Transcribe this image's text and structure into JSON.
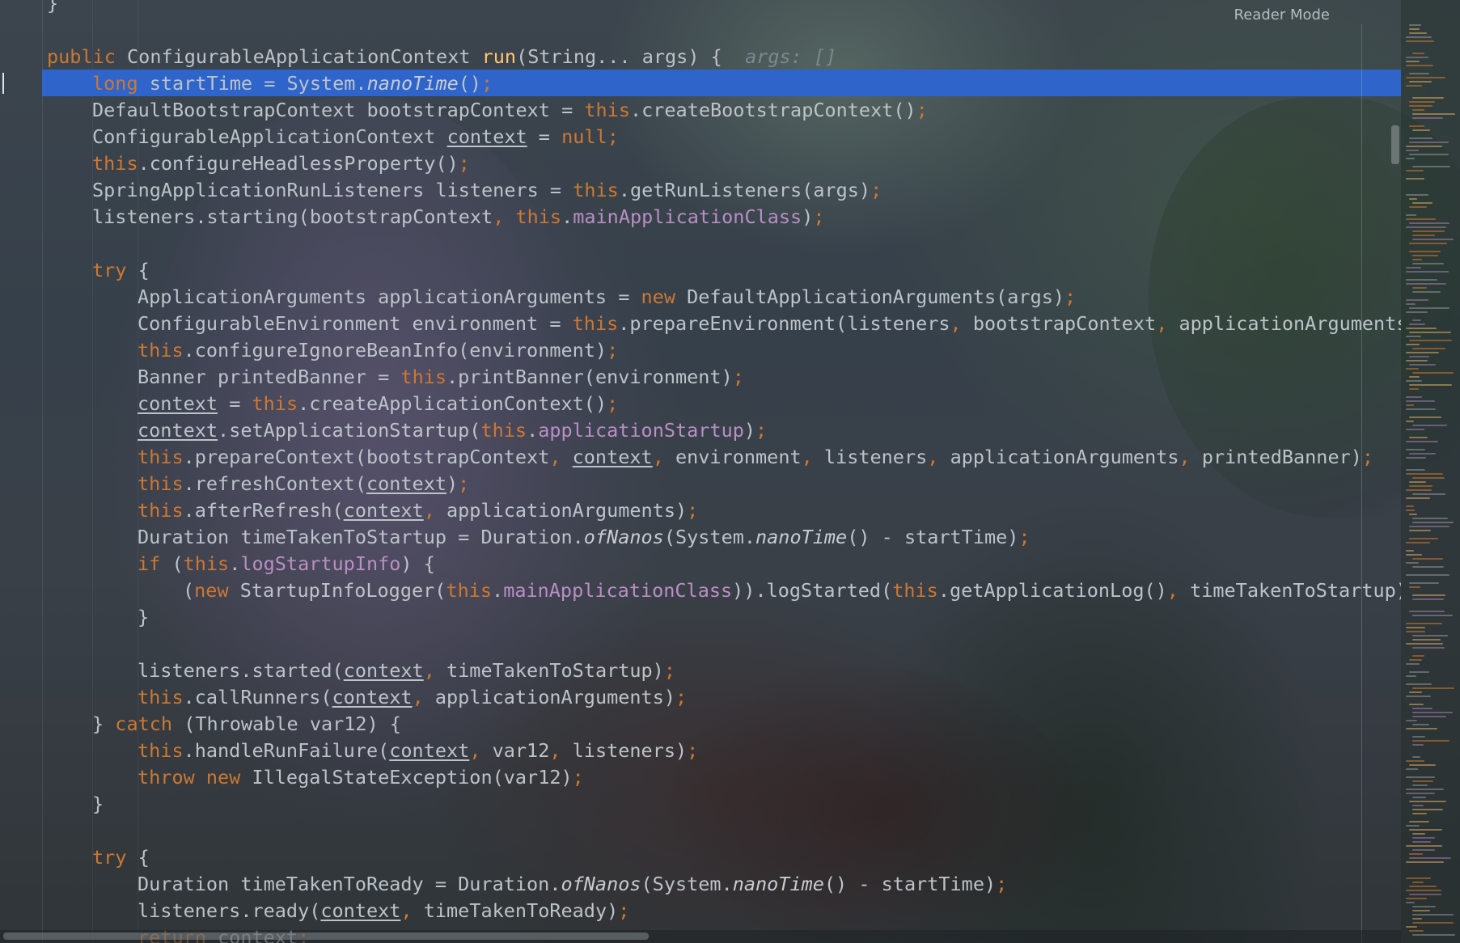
{
  "editor": {
    "reader_mode_label": "Reader Mode",
    "language": "java",
    "caret_line_index": 2,
    "inlay_hint": "args: []",
    "colors": {
      "keyword": "#cc7832",
      "method_declaration": "#ffc66d",
      "field": "#b98fc4",
      "plain": "#bcc3c9",
      "caret_line": "#2f65ca",
      "hint": "#7f8790"
    }
  },
  "code_lines": [
    {
      "indent": 0,
      "tokens": [
        {
          "t": "}",
          "c": "plain"
        }
      ]
    },
    {
      "indent": 0,
      "tokens": []
    },
    {
      "indent": 0,
      "tokens": [
        {
          "t": "public",
          "c": "kw"
        },
        {
          "t": " ConfigurableApplicationContext ",
          "c": "plain"
        },
        {
          "t": "run",
          "c": "fn"
        },
        {
          "t": "(String... args) {  ",
          "c": "plain"
        },
        {
          "t": "args: []",
          "c": "hint"
        }
      ]
    },
    {
      "indent": 1,
      "tokens": [
        {
          "t": "long",
          "c": "kw"
        },
        {
          "t": " startTime = System.",
          "c": "plain"
        },
        {
          "t": "nanoTime",
          "c": "static"
        },
        {
          "t": "()",
          "c": "plain"
        },
        {
          "t": ";",
          "c": "kw"
        }
      ]
    },
    {
      "indent": 1,
      "tokens": [
        {
          "t": "DefaultBootstrapContext bootstrapContext = ",
          "c": "plain"
        },
        {
          "t": "this",
          "c": "kw"
        },
        {
          "t": ".createBootstrapContext()",
          "c": "plain"
        },
        {
          "t": ";",
          "c": "kw"
        }
      ]
    },
    {
      "indent": 1,
      "tokens": [
        {
          "t": "ConfigurableApplicationContext ",
          "c": "plain"
        },
        {
          "t": "context",
          "c": "ul"
        },
        {
          "t": " = ",
          "c": "plain"
        },
        {
          "t": "null",
          "c": "kw"
        },
        {
          "t": ";",
          "c": "kw"
        }
      ]
    },
    {
      "indent": 1,
      "tokens": [
        {
          "t": "this",
          "c": "kw"
        },
        {
          "t": ".configureHeadlessProperty()",
          "c": "plain"
        },
        {
          "t": ";",
          "c": "kw"
        }
      ]
    },
    {
      "indent": 1,
      "tokens": [
        {
          "t": "SpringApplicationRunListeners listeners = ",
          "c": "plain"
        },
        {
          "t": "this",
          "c": "kw"
        },
        {
          "t": ".getRunListeners(args)",
          "c": "plain"
        },
        {
          "t": ";",
          "c": "kw"
        }
      ]
    },
    {
      "indent": 1,
      "tokens": [
        {
          "t": "listeners.starting(bootstrapContext",
          "c": "plain"
        },
        {
          "t": ", ",
          "c": "kw"
        },
        {
          "t": "this",
          "c": "kw"
        },
        {
          "t": ".",
          "c": "plain"
        },
        {
          "t": "mainApplicationClass",
          "c": "field"
        },
        {
          "t": ")",
          "c": "plain"
        },
        {
          "t": ";",
          "c": "kw"
        }
      ]
    },
    {
      "indent": 0,
      "tokens": []
    },
    {
      "indent": 1,
      "tokens": [
        {
          "t": "try",
          "c": "kw"
        },
        {
          "t": " {",
          "c": "plain"
        }
      ]
    },
    {
      "indent": 2,
      "tokens": [
        {
          "t": "ApplicationArguments applicationArguments = ",
          "c": "plain"
        },
        {
          "t": "new",
          "c": "kw"
        },
        {
          "t": " DefaultApplicationArguments(args)",
          "c": "plain"
        },
        {
          "t": ";",
          "c": "kw"
        }
      ]
    },
    {
      "indent": 2,
      "tokens": [
        {
          "t": "ConfigurableEnvironment environment = ",
          "c": "plain"
        },
        {
          "t": "this",
          "c": "kw"
        },
        {
          "t": ".prepareEnvironment(listeners",
          "c": "plain"
        },
        {
          "t": ", ",
          "c": "kw"
        },
        {
          "t": "bootstrapContext",
          "c": "plain"
        },
        {
          "t": ", ",
          "c": "kw"
        },
        {
          "t": "applicationArguments)",
          "c": "plain"
        }
      ]
    },
    {
      "indent": 2,
      "tokens": [
        {
          "t": "this",
          "c": "kw"
        },
        {
          "t": ".configureIgnoreBeanInfo(environment)",
          "c": "plain"
        },
        {
          "t": ";",
          "c": "kw"
        }
      ]
    },
    {
      "indent": 2,
      "tokens": [
        {
          "t": "Banner printedBanner = ",
          "c": "plain"
        },
        {
          "t": "this",
          "c": "kw"
        },
        {
          "t": ".printBanner(environment)",
          "c": "plain"
        },
        {
          "t": ";",
          "c": "kw"
        }
      ]
    },
    {
      "indent": 2,
      "tokens": [
        {
          "t": "context",
          "c": "ul"
        },
        {
          "t": " = ",
          "c": "plain"
        },
        {
          "t": "this",
          "c": "kw"
        },
        {
          "t": ".createApplicationContext()",
          "c": "plain"
        },
        {
          "t": ";",
          "c": "kw"
        }
      ]
    },
    {
      "indent": 2,
      "tokens": [
        {
          "t": "context",
          "c": "ul"
        },
        {
          "t": ".setApplicationStartup(",
          "c": "plain"
        },
        {
          "t": "this",
          "c": "kw"
        },
        {
          "t": ".",
          "c": "plain"
        },
        {
          "t": "applicationStartup",
          "c": "field"
        },
        {
          "t": ")",
          "c": "plain"
        },
        {
          "t": ";",
          "c": "kw"
        }
      ]
    },
    {
      "indent": 2,
      "tokens": [
        {
          "t": "this",
          "c": "kw"
        },
        {
          "t": ".prepareContext(bootstrapContext",
          "c": "plain"
        },
        {
          "t": ", ",
          "c": "kw"
        },
        {
          "t": "context",
          "c": "ul"
        },
        {
          "t": ", ",
          "c": "kw"
        },
        {
          "t": "environment",
          "c": "plain"
        },
        {
          "t": ", ",
          "c": "kw"
        },
        {
          "t": "listeners",
          "c": "plain"
        },
        {
          "t": ", ",
          "c": "kw"
        },
        {
          "t": "applicationArguments",
          "c": "plain"
        },
        {
          "t": ", ",
          "c": "kw"
        },
        {
          "t": "printedBanner)",
          "c": "plain"
        },
        {
          "t": ";",
          "c": "kw"
        }
      ]
    },
    {
      "indent": 2,
      "tokens": [
        {
          "t": "this",
          "c": "kw"
        },
        {
          "t": ".refreshContext(",
          "c": "plain"
        },
        {
          "t": "context",
          "c": "ul"
        },
        {
          "t": ")",
          "c": "plain"
        },
        {
          "t": ";",
          "c": "kw"
        }
      ]
    },
    {
      "indent": 2,
      "tokens": [
        {
          "t": "this",
          "c": "kw"
        },
        {
          "t": ".afterRefresh(",
          "c": "plain"
        },
        {
          "t": "context",
          "c": "ul"
        },
        {
          "t": ", ",
          "c": "kw"
        },
        {
          "t": "applicationArguments)",
          "c": "plain"
        },
        {
          "t": ";",
          "c": "kw"
        }
      ]
    },
    {
      "indent": 2,
      "tokens": [
        {
          "t": "Duration timeTakenToStartup = Duration.",
          "c": "plain"
        },
        {
          "t": "ofNanos",
          "c": "static"
        },
        {
          "t": "(System.",
          "c": "plain"
        },
        {
          "t": "nanoTime",
          "c": "static"
        },
        {
          "t": "() - startTime)",
          "c": "plain"
        },
        {
          "t": ";",
          "c": "kw"
        }
      ]
    },
    {
      "indent": 2,
      "tokens": [
        {
          "t": "if",
          "c": "kw"
        },
        {
          "t": " (",
          "c": "plain"
        },
        {
          "t": "this",
          "c": "kw"
        },
        {
          "t": ".",
          "c": "plain"
        },
        {
          "t": "logStartupInfo",
          "c": "field"
        },
        {
          "t": ") {",
          "c": "plain"
        }
      ]
    },
    {
      "indent": 3,
      "tokens": [
        {
          "t": "(",
          "c": "plain"
        },
        {
          "t": "new",
          "c": "kw"
        },
        {
          "t": " StartupInfoLogger(",
          "c": "plain"
        },
        {
          "t": "this",
          "c": "kw"
        },
        {
          "t": ".",
          "c": "plain"
        },
        {
          "t": "mainApplicationClass",
          "c": "field"
        },
        {
          "t": ")).logStarted(",
          "c": "plain"
        },
        {
          "t": "this",
          "c": "kw"
        },
        {
          "t": ".getApplicationLog()",
          "c": "plain"
        },
        {
          "t": ", ",
          "c": "kw"
        },
        {
          "t": "timeTakenToStartup)",
          "c": "plain"
        },
        {
          "t": ";",
          "c": "kw"
        }
      ]
    },
    {
      "indent": 2,
      "tokens": [
        {
          "t": "}",
          "c": "plain"
        }
      ]
    },
    {
      "indent": 0,
      "tokens": []
    },
    {
      "indent": 2,
      "tokens": [
        {
          "t": "listeners.started(",
          "c": "plain"
        },
        {
          "t": "context",
          "c": "ul"
        },
        {
          "t": ", ",
          "c": "kw"
        },
        {
          "t": "timeTakenToStartup)",
          "c": "plain"
        },
        {
          "t": ";",
          "c": "kw"
        }
      ]
    },
    {
      "indent": 2,
      "tokens": [
        {
          "t": "this",
          "c": "kw"
        },
        {
          "t": ".callRunners(",
          "c": "plain"
        },
        {
          "t": "context",
          "c": "ul"
        },
        {
          "t": ", ",
          "c": "kw"
        },
        {
          "t": "applicationArguments)",
          "c": "plain"
        },
        {
          "t": ";",
          "c": "kw"
        }
      ]
    },
    {
      "indent": 1,
      "tokens": [
        {
          "t": "} ",
          "c": "plain"
        },
        {
          "t": "catch",
          "c": "kw"
        },
        {
          "t": " (Throwable var12) {",
          "c": "plain"
        }
      ]
    },
    {
      "indent": 2,
      "tokens": [
        {
          "t": "this",
          "c": "kw"
        },
        {
          "t": ".handleRunFailure(",
          "c": "plain"
        },
        {
          "t": "context",
          "c": "ul"
        },
        {
          "t": ", ",
          "c": "kw"
        },
        {
          "t": "var12",
          "c": "plain"
        },
        {
          "t": ", ",
          "c": "kw"
        },
        {
          "t": "listeners)",
          "c": "plain"
        },
        {
          "t": ";",
          "c": "kw"
        }
      ]
    },
    {
      "indent": 2,
      "tokens": [
        {
          "t": "throw new",
          "c": "kw"
        },
        {
          "t": " IllegalStateException(var12)",
          "c": "plain"
        },
        {
          "t": ";",
          "c": "kw"
        }
      ]
    },
    {
      "indent": 1,
      "tokens": [
        {
          "t": "}",
          "c": "plain"
        }
      ]
    },
    {
      "indent": 0,
      "tokens": []
    },
    {
      "indent": 1,
      "tokens": [
        {
          "t": "try",
          "c": "kw"
        },
        {
          "t": " {",
          "c": "plain"
        }
      ]
    },
    {
      "indent": 2,
      "tokens": [
        {
          "t": "Duration timeTakenToReady = Duration.",
          "c": "plain"
        },
        {
          "t": "ofNanos",
          "c": "static"
        },
        {
          "t": "(System.",
          "c": "plain"
        },
        {
          "t": "nanoTime",
          "c": "static"
        },
        {
          "t": "() - startTime)",
          "c": "plain"
        },
        {
          "t": ";",
          "c": "kw"
        }
      ]
    },
    {
      "indent": 2,
      "tokens": [
        {
          "t": "listeners.ready(",
          "c": "plain"
        },
        {
          "t": "context",
          "c": "ul"
        },
        {
          "t": ", ",
          "c": "kw"
        },
        {
          "t": "timeTakenToReady)",
          "c": "plain"
        },
        {
          "t": ";",
          "c": "kw"
        }
      ]
    },
    {
      "indent": 2,
      "tokens": [
        {
          "t": "return",
          "c": "kw"
        },
        {
          "t": " context",
          "c": "plain"
        },
        {
          "t": ";",
          "c": "kw"
        }
      ]
    }
  ]
}
